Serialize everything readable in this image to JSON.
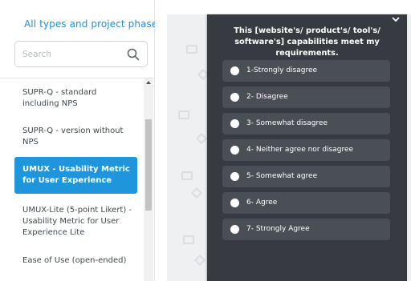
{
  "sidebar": {
    "filter_label": "All types and project phases",
    "search_placeholder": "Search",
    "items": [
      {
        "label": "SUPR-Q - standard including NPS"
      },
      {
        "label": "SUPR-Q - version without NPS"
      },
      {
        "label": "UMUX - Usability Metric for User Experience"
      },
      {
        "label": "UMUX-Lite (5-point Likert) - Usability Metric for User Experience Lite"
      },
      {
        "label": "Ease of Use (open-ended)"
      }
    ],
    "active_index": 2
  },
  "panel": {
    "question": "This [website's/ product's/ tool's/ software's] capabilities meet my requirements.",
    "options": [
      {
        "label": "1-Strongly disagree"
      },
      {
        "label": "2- Disagree"
      },
      {
        "label": "3- Somewhat disagree"
      },
      {
        "label": "4- Neither agree nor disagree"
      },
      {
        "label": "5- Somewhat agree"
      },
      {
        "label": "6- Agree"
      },
      {
        "label": "7- Strongly Agree"
      }
    ]
  },
  "colors": {
    "accent": "#1f95db",
    "panel_bg": "#373b41",
    "option_bg": "#4a4e55"
  },
  "icons": {
    "filter_chevron": "chevron-down-icon",
    "search": "search-icon",
    "collapse": "chevron-down-icon"
  }
}
